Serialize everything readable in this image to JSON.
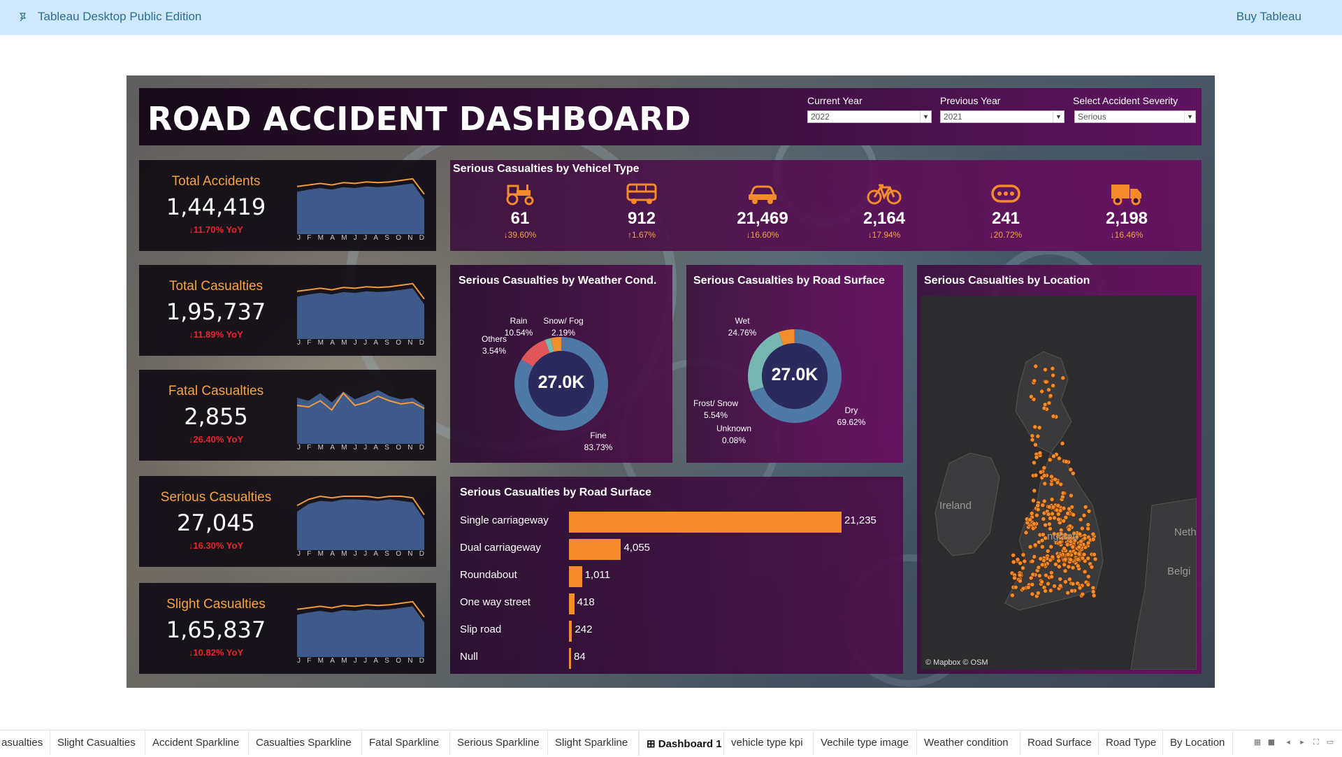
{
  "topbar": {
    "app_title": "Tableau Desktop Public Edition",
    "buy_label": "Buy Tableau"
  },
  "header": {
    "title": "ROAD ACCIDENT DASHBOARD",
    "filters": [
      {
        "label": "Current Year",
        "value": "2022"
      },
      {
        "label": "Previous Year",
        "value": "2021"
      },
      {
        "label": "Select Accident Severity",
        "value": "Serious"
      }
    ]
  },
  "kpis": [
    {
      "name": "Total Accidents",
      "value": "1,44,419",
      "yoy": "↓11.70% YoY"
    },
    {
      "name": "Total Casualties",
      "value": "1,95,737",
      "yoy": "↓11.89% YoY"
    },
    {
      "name": "Fatal Casualties",
      "value": "2,855",
      "yoy": "↓26.40%  YoY"
    },
    {
      "name": "Serious Casualties",
      "value": "27,045",
      "yoy": "↓16.30%  YoY"
    },
    {
      "name": "Slight Casualties",
      "value": "1,65,837",
      "yoy": "↓10.82%  YoY"
    }
  ],
  "months": [
    "J",
    "F",
    "M",
    "A",
    "M",
    "J",
    "J",
    "A",
    "S",
    "O",
    "N",
    "D"
  ],
  "vehicle": {
    "title": "Serious Casualties by Vehicel Type",
    "items": [
      {
        "icon": "tractor-icon",
        "value": "61",
        "change": "↓39.60%"
      },
      {
        "icon": "bus-icon",
        "value": "912",
        "change": "↑1.67%"
      },
      {
        "icon": "car-icon",
        "value": "21,469",
        "change": "↓16.60%"
      },
      {
        "icon": "bicycle-icon",
        "value": "2,164",
        "change": "↓17.94%"
      },
      {
        "icon": "other-vehicle-icon",
        "value": "241",
        "change": "↓20.72%"
      },
      {
        "icon": "truck-icon",
        "value": "2,198",
        "change": "↓16.46%"
      }
    ]
  },
  "weather": {
    "title": "Serious Casualties by Weather Cond.",
    "center": "27.0K",
    "labels": [
      {
        "name": "Rain",
        "pct": "10.54%"
      },
      {
        "name": "Snow/ Fog",
        "pct": "2.19%"
      },
      {
        "name": "Others",
        "pct": "3.54%"
      },
      {
        "name": "Fine",
        "pct": "83.73%"
      }
    ]
  },
  "surface_donut": {
    "title": "Serious Casualties by Road Surface",
    "center": "27.0K",
    "labels": [
      {
        "name": "Wet",
        "pct": "24.76%"
      },
      {
        "name": "Frost/ Snow",
        "pct": "5.54%"
      },
      {
        "name": "Unknown",
        "pct": "0.08%"
      },
      {
        "name": "Dry",
        "pct": "69.62%"
      }
    ]
  },
  "location": {
    "title": "Serious Casualties by Location",
    "labels": {
      "ireland": "Ireland",
      "neth": "Neth",
      "belg": "Belgi",
      "center": "ngland"
    },
    "credit": "© Mapbox © OSM"
  },
  "roadbar": {
    "title": "Serious Casualties by Road Surface"
  },
  "chart_data": [
    {
      "type": "bar",
      "title": "Serious Casualties by Road Surface",
      "categories": [
        "Single carriageway",
        "Dual carriageway",
        "Roundabout",
        "One way street",
        "Slip road",
        "Null"
      ],
      "values": [
        21235,
        4055,
        1011,
        418,
        242,
        84
      ],
      "value_labels": [
        "21,235",
        "4,055",
        "1,011",
        "418",
        "242",
        "84"
      ]
    },
    {
      "type": "pie",
      "title": "Serious Casualties by Weather Cond.",
      "categories": [
        "Fine",
        "Rain",
        "Snow/ Fog",
        "Others"
      ],
      "values": [
        83.73,
        10.54,
        2.19,
        3.54
      ],
      "colors": [
        "#4e79a7",
        "#e15759",
        "#76b7b2",
        "#f28e2b"
      ]
    },
    {
      "type": "pie",
      "title": "Serious Casualties by Road Surface",
      "categories": [
        "Dry",
        "Wet",
        "Frost/ Snow",
        "Unknown"
      ],
      "values": [
        69.62,
        24.76,
        5.54,
        0.08
      ],
      "colors": [
        "#4e79a7",
        "#76b7b2",
        "#f28e2b",
        "#e15759"
      ]
    }
  ],
  "sparklines": [
    {
      "area": [
        55,
        58,
        60,
        58,
        61,
        60,
        62,
        61,
        62,
        64,
        66,
        45
      ],
      "line": [
        62,
        64,
        66,
        64,
        67,
        66,
        68,
        67,
        68,
        70,
        72,
        52
      ]
    },
    {
      "area": [
        55,
        58,
        60,
        58,
        61,
        60,
        62,
        61,
        62,
        64,
        66,
        45
      ],
      "line": [
        62,
        64,
        66,
        64,
        67,
        66,
        68,
        67,
        68,
        70,
        72,
        52
      ]
    },
    {
      "area": [
        60,
        56,
        66,
        54,
        68,
        58,
        64,
        70,
        62,
        58,
        60,
        50
      ],
      "line": [
        50,
        48,
        56,
        44,
        66,
        50,
        54,
        62,
        56,
        52,
        54,
        46
      ]
    },
    {
      "area": [
        50,
        60,
        64,
        63,
        66,
        66,
        65,
        64,
        66,
        64,
        62,
        40
      ],
      "line": [
        58,
        66,
        70,
        68,
        70,
        70,
        70,
        68,
        70,
        70,
        68,
        46
      ]
    },
    {
      "area": [
        55,
        58,
        60,
        58,
        61,
        60,
        62,
        61,
        62,
        64,
        66,
        45
      ],
      "line": [
        62,
        64,
        66,
        64,
        67,
        66,
        68,
        67,
        68,
        70,
        72,
        52
      ]
    }
  ],
  "colors": {
    "orange": "#f58b2a",
    "kpi_title": "#f6a343",
    "yoy_red": "#e8262e",
    "spark_area": "#3e5a8a",
    "spark_line": "#f29a3c"
  },
  "tabs": [
    "asualties",
    "Slight Casualties",
    "Accident Sparkline",
    "Casualties Sparkline",
    "Fatal Sparkline",
    "Serious Sparkline",
    "Slight Sparkline",
    "Dashboard 1",
    "vehicle type kpi",
    "Vechile type image",
    "Weather condition",
    "Road Surface",
    "Road Type",
    "By Location"
  ],
  "active_tab": "Dashboard 1"
}
